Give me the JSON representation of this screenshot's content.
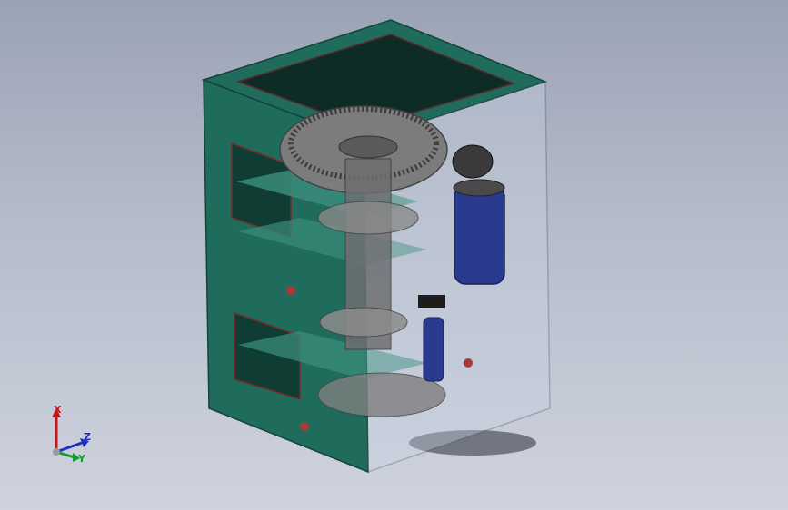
{
  "viewport": {
    "background_top": "#9aa3b5",
    "background_bottom": "#cfd3de"
  },
  "model": {
    "housing_color": "#1f6b5c",
    "glass_color": "#c9d3e2",
    "motor_color": "#2a3a8f",
    "gear_color": "#8d8d8d"
  },
  "triad": {
    "x_label": "X",
    "y_label": "Y",
    "z_label": "Z",
    "x_color": "#c41616",
    "y_color": "#139a2e",
    "z_color": "#1d2fc4"
  }
}
